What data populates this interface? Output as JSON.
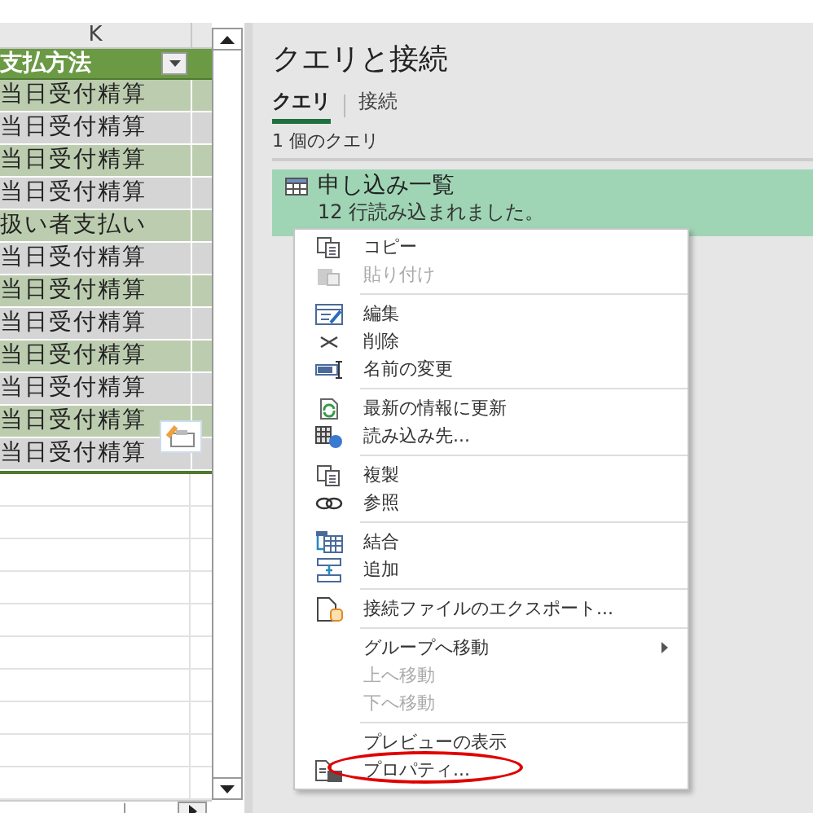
{
  "sheet": {
    "column_header": "K",
    "header_cell": "支払方法",
    "rows": [
      {
        "text": "当日受付精算",
        "kind": "green"
      },
      {
        "text": "当日受付精算",
        "kind": "gray"
      },
      {
        "text": "当日受付精算",
        "kind": "green"
      },
      {
        "text": "当日受付精算",
        "kind": "gray"
      },
      {
        "text": "扱い者支払い",
        "kind": "green"
      },
      {
        "text": "当日受付精算",
        "kind": "gray"
      },
      {
        "text": "当日受付精算",
        "kind": "green"
      },
      {
        "text": "当日受付精算",
        "kind": "gray"
      },
      {
        "text": "当日受付精算",
        "kind": "green"
      },
      {
        "text": "当日受付精算",
        "kind": "gray"
      },
      {
        "text": "当日受付精算",
        "kind": "green"
      },
      {
        "text": "当日受付精算",
        "kind": "gray"
      }
    ]
  },
  "pane": {
    "title": "クエリと接続",
    "tabs": [
      {
        "label": "クエリ",
        "selected": true
      },
      {
        "label": "接続",
        "selected": false
      }
    ],
    "count": "1 個のクエリ",
    "query": {
      "name": "申し込み一覧",
      "status": "12 行読み込まれました。",
      "selected": true
    }
  },
  "context_menu": {
    "items": [
      {
        "kind": "item",
        "label": "コピー",
        "disabled": false
      },
      {
        "kind": "item",
        "label": "貼り付け",
        "disabled": true
      },
      {
        "kind": "separator"
      },
      {
        "kind": "item",
        "label": "編集",
        "disabled": false
      },
      {
        "kind": "item",
        "label": "削除",
        "disabled": false
      },
      {
        "kind": "item",
        "label": "名前の変更",
        "disabled": false
      },
      {
        "kind": "separator"
      },
      {
        "kind": "item",
        "label": "最新の情報に更新",
        "disabled": false
      },
      {
        "kind": "item",
        "label": "読み込み先...",
        "disabled": false
      },
      {
        "kind": "separator"
      },
      {
        "kind": "item",
        "label": "複製",
        "disabled": false
      },
      {
        "kind": "item",
        "label": "参照",
        "disabled": false
      },
      {
        "kind": "separator"
      },
      {
        "kind": "item",
        "label": "結合",
        "disabled": false
      },
      {
        "kind": "item",
        "label": "追加",
        "disabled": false
      },
      {
        "kind": "separator"
      },
      {
        "kind": "item",
        "label": "接続ファイルのエクスポート...",
        "disabled": false
      },
      {
        "kind": "separator"
      },
      {
        "kind": "submenu",
        "label": "グループへ移動",
        "disabled": false
      },
      {
        "kind": "item",
        "label": "上へ移動",
        "disabled": true
      },
      {
        "kind": "item",
        "label": "下へ移動",
        "disabled": true
      },
      {
        "kind": "separator"
      },
      {
        "kind": "item",
        "label": "プレビューの表示",
        "disabled": false
      },
      {
        "kind": "item",
        "label": "プロパティ...",
        "disabled": false,
        "circled": true
      }
    ]
  }
}
